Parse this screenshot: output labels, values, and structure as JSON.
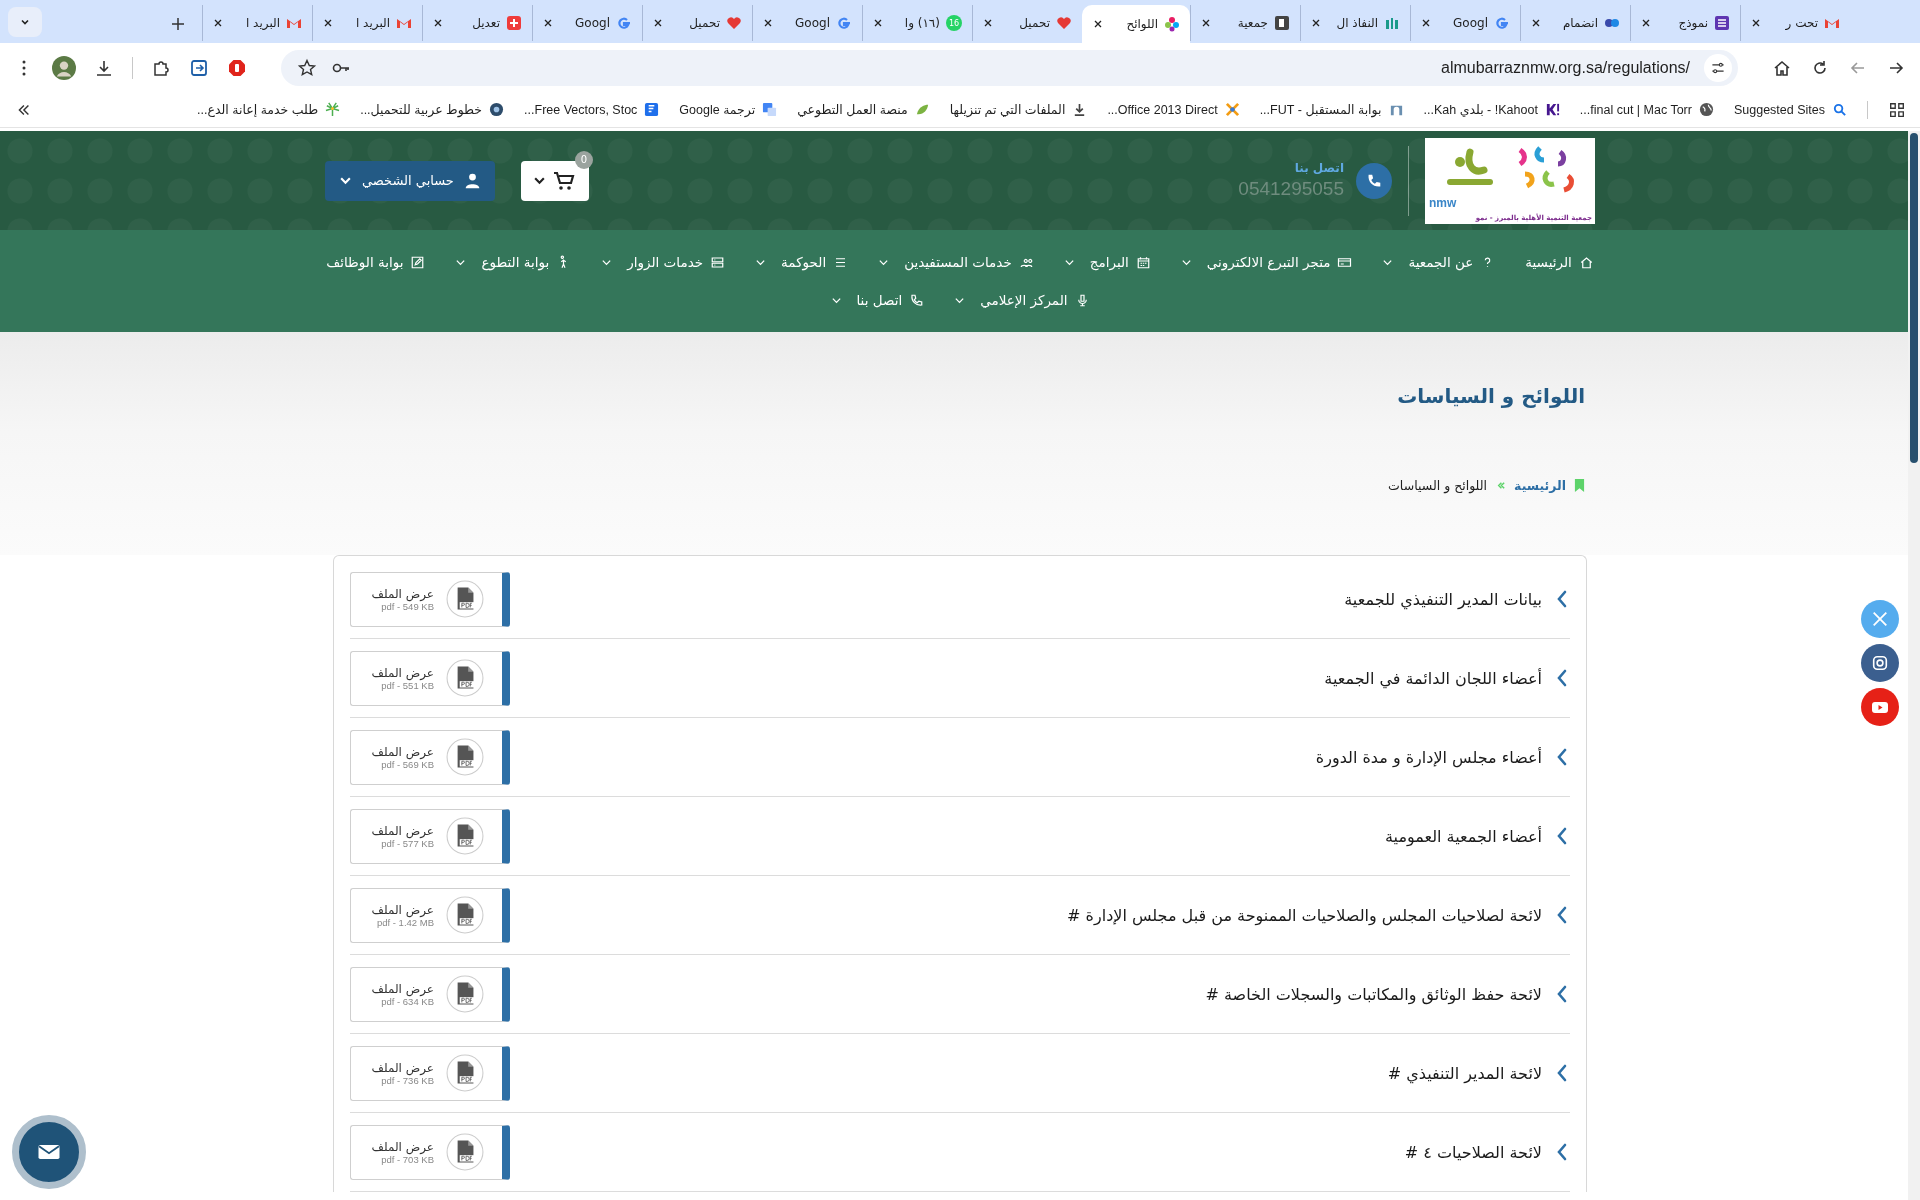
{
  "browser": {
    "tabs": [
      {
        "title": "تحت ر",
        "kind": "mail",
        "selected": false
      },
      {
        "title": "نموذج",
        "kind": "form",
        "selected": false
      },
      {
        "title": "انضمام",
        "kind": "people",
        "selected": false
      },
      {
        "title": "Googl",
        "kind": "google",
        "selected": false
      },
      {
        "title": "النفاذ ال",
        "kind": "gate",
        "selected": false
      },
      {
        "title": "جمعية",
        "kind": "square",
        "selected": false
      },
      {
        "title": "اللوائح",
        "kind": "flower",
        "selected": true
      },
      {
        "title": "تحميل",
        "kind": "heart",
        "selected": false
      },
      {
        "title": "(١٦) وا",
        "kind": "chat",
        "badge": "16",
        "selected": false
      },
      {
        "title": "Googl",
        "kind": "google",
        "selected": false
      },
      {
        "title": "تحميل",
        "kind": "heart",
        "selected": false
      },
      {
        "title": "Googl",
        "kind": "google",
        "selected": false
      },
      {
        "title": "تعديل",
        "kind": "plus",
        "selected": false
      },
      {
        "title": "البريد ا",
        "kind": "mail",
        "selected": false
      },
      {
        "title": "البريد ا",
        "kind": "mail",
        "selected": false
      }
    ],
    "url": "almubarraznmw.org.sa/regulations/",
    "bookmarks": [
      {
        "title": "Suggested Sites",
        "kind": "search"
      },
      {
        "title": "final cut | Mac Torr...",
        "kind": "globe"
      },
      {
        "title": "Kahoot! - بلدي Kah...",
        "kind": "mark"
      },
      {
        "title": "بوابة المستقبل - FUT...",
        "kind": "gate"
      },
      {
        "title": "Office 2013 Direct...",
        "kind": "cross"
      },
      {
        "title": "الملفات التي تم تنزيلها",
        "kind": "download"
      },
      {
        "title": "منصة العمل التطوعي",
        "kind": "leaf"
      },
      {
        "title": "ترجمة Google",
        "kind": "translate"
      },
      {
        "title": "Free Vectors, Stoc...",
        "kind": "doc"
      },
      {
        "title": "خطوط عربية للتحميل...",
        "kind": "circle"
      },
      {
        "title": "طلب خدمة إعانة الدع...",
        "kind": "palm"
      }
    ]
  },
  "header": {
    "logo": {
      "latin": "nmw",
      "caption": "جمعية التنمية الأهلية بالمبرز - نمو"
    },
    "contact": {
      "label": "اتصل بنا",
      "phone": "0541295055"
    },
    "cart": {
      "count": "0"
    },
    "account": {
      "label": "حسابي الشخصي"
    }
  },
  "nav_rows": [
    {
      "items": [
        {
          "label": "الرئيسية",
          "has_menu": false
        },
        {
          "label": "عن الجمعية",
          "has_menu": true
        },
        {
          "label": "متجر التبرع الالكتروني",
          "has_menu": true
        },
        {
          "label": "البرامج",
          "has_menu": true
        },
        {
          "label": "خدمات المستفيدين",
          "has_menu": true
        },
        {
          "label": "الحوكمة",
          "has_menu": true
        },
        {
          "label": "خدمات الزوار",
          "has_menu": true
        },
        {
          "label": "بوابة التطوع",
          "has_menu": true
        },
        {
          "label": "بوابة الوظائف",
          "has_menu": false
        }
      ]
    },
    {
      "items": [
        {
          "label": "المركز الإعلامي",
          "has_menu": true
        },
        {
          "label": "اتصل بنا",
          "has_menu": true
        }
      ]
    }
  ],
  "page": {
    "title": "اللوائح و السياسات",
    "breadcrumb": [
      {
        "label": "الرئيسية",
        "link": true
      },
      {
        "label": "اللوائح و السياسات",
        "link": false
      }
    ]
  },
  "files": [
    {
      "title": "بيانات المدير التنفيذي للجمعية",
      "action": "عرض الملف",
      "meta": "pdf - 549 KB"
    },
    {
      "title": "أعضاء اللجان الدائمة في الجمعية",
      "action": "عرض الملف",
      "meta": "pdf - 551 KB"
    },
    {
      "title": "أعضاء مجلس الإدارة و مدة الدورة",
      "action": "عرض الملف",
      "meta": "pdf - 569 KB"
    },
    {
      "title": "أعضاء الجمعية العمومية",
      "action": "عرض الملف",
      "meta": "pdf - 577 KB"
    },
    {
      "title": "لائحة لصلاحيات المجلس والصلاحيات الممنوحة من قبل مجلس الإدارة #",
      "action": "عرض الملف",
      "meta": "pdf - 1.42 MB"
    },
    {
      "title": "لائحة حفظ الوثائق والمكاتبات والسجلات الخاصة #",
      "action": "عرض الملف",
      "meta": "pdf - 634 KB"
    },
    {
      "title": "لائحة المدير التنفيذي #",
      "action": "عرض الملف",
      "meta": "pdf - 736 KB"
    },
    {
      "title": "لائحة الصلاحيات ٤ #",
      "action": "عرض الملف",
      "meta": "pdf - 703 KB"
    }
  ]
}
